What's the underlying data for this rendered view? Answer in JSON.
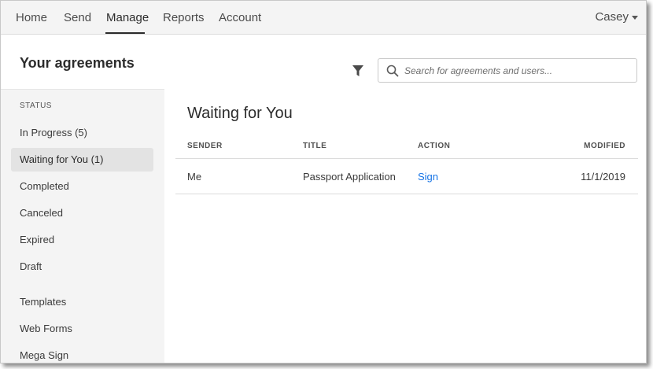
{
  "nav": {
    "items": [
      "Home",
      "Send",
      "Manage",
      "Reports",
      "Account"
    ],
    "active": "Manage",
    "user": "Casey"
  },
  "header": {
    "title": "Your agreements",
    "search_placeholder": "Search for agreements and users..."
  },
  "sidebar": {
    "heading": "STATUS",
    "items": [
      {
        "label": "In Progress (5)"
      },
      {
        "label": "Waiting for You (1)",
        "selected": true
      },
      {
        "label": "Completed"
      },
      {
        "label": "Canceled"
      },
      {
        "label": "Expired"
      },
      {
        "label": "Draft"
      },
      {
        "label": "Templates"
      },
      {
        "label": "Web Forms"
      },
      {
        "label": "Mega Sign"
      }
    ]
  },
  "main": {
    "title": "Waiting for You",
    "columns": [
      "SENDER",
      "TITLE",
      "ACTION",
      "MODIFIED"
    ],
    "rows": [
      {
        "sender": "Me",
        "title": "Passport Application",
        "action": "Sign",
        "modified": "11/1/2019"
      }
    ]
  },
  "colors": {
    "link": "#1473e6",
    "sidebar_bg": "#f4f4f4",
    "selected_bg": "#e3e3e3"
  }
}
